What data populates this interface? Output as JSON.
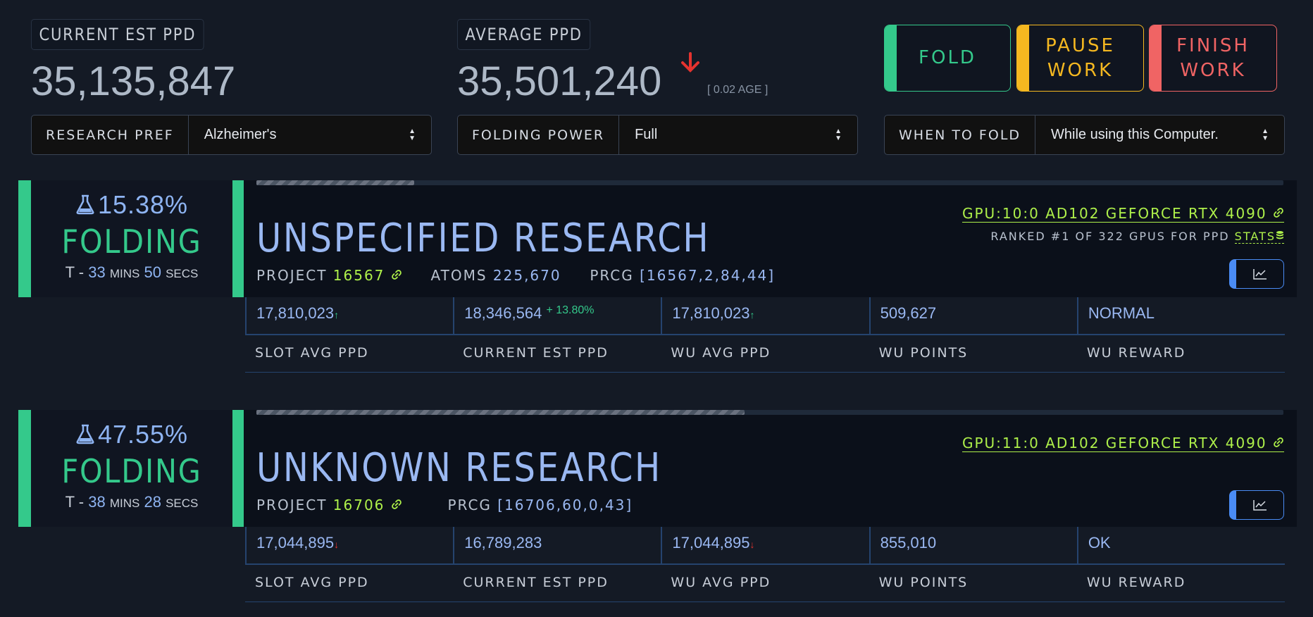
{
  "header": {
    "current_est_ppd_label": "CURRENT EST PPD",
    "current_est_ppd_value": "35,135,847",
    "average_ppd_label": "AVERAGE PPD",
    "average_ppd_value": "35,501,240",
    "average_age": "[ 0.02 AGE ]",
    "trend": "down"
  },
  "actions": {
    "fold_label": "FOLD",
    "pause_line1": "PAUSE",
    "pause_line2": "WORK",
    "finish_line1": "FINISH",
    "finish_line2": "WORK",
    "colors": {
      "fold": "#34c98b",
      "pause": "#f5b820",
      "finish": "#f06464"
    }
  },
  "selects": {
    "research_pref": {
      "label": "RESEARCH PREF",
      "value": "Alzheimer's"
    },
    "folding_power": {
      "label": "FOLDING POWER",
      "value": "Full"
    },
    "when_to_fold": {
      "label": "WHEN TO FOLD",
      "value": "While using this Computer."
    }
  },
  "slots": [
    {
      "percent": "15.38%",
      "status": "FOLDING",
      "eta_prefix": "T -",
      "eta_mins": "33",
      "eta_mins_label": "MINS",
      "eta_secs": "50",
      "eta_secs_label": "SECS",
      "progress_fraction": 0.1538,
      "title": "UNSPECIFIED RESEARCH",
      "project_label": "PROJECT",
      "project": "16567",
      "atoms_label": "ATOMS",
      "atoms": "225,670",
      "prcg_label": "PRCG",
      "prcg": "[16567,2,84,44]",
      "gpu": "GPU:10:0 AD102 GEFORCE RTX 4090",
      "ranked": "RANKED #1 OF 322 GPUS FOR PPD",
      "stats_label": "STATS",
      "metrics": {
        "slot_avg_ppd": "17,810,023",
        "slot_avg_trend": "up",
        "current_est_ppd": "18,346,564",
        "current_change": "+ 13.80%",
        "wu_avg_ppd": "17,810,023",
        "wu_avg_trend": "up",
        "wu_points": "509,627",
        "wu_reward": "NORMAL"
      }
    },
    {
      "percent": "47.55%",
      "status": "FOLDING",
      "eta_prefix": "T -",
      "eta_mins": "38",
      "eta_mins_label": "MINS",
      "eta_secs": "28",
      "eta_secs_label": "SECS",
      "progress_fraction": 0.4755,
      "title": "UNKNOWN RESEARCH",
      "project_label": "PROJECT",
      "project": "16706",
      "prcg_label": "PRCG",
      "prcg": "[16706,60,0,43]",
      "gpu": "GPU:11:0 AD102 GEFORCE RTX 4090",
      "metrics": {
        "slot_avg_ppd": "17,044,895",
        "slot_avg_trend": "down",
        "current_est_ppd": "16,789,283",
        "wu_avg_ppd": "17,044,895",
        "wu_avg_trend": "down",
        "wu_points": "855,010",
        "wu_reward": "OK"
      }
    }
  ],
  "metric_labels": {
    "slot_avg_ppd": "SLOT AVG PPD",
    "current_est_ppd": "CURRENT EST PPD",
    "wu_avg_ppd": "WU AVG PPD",
    "wu_points": "WU POINTS",
    "wu_reward": "WU REWARD"
  }
}
